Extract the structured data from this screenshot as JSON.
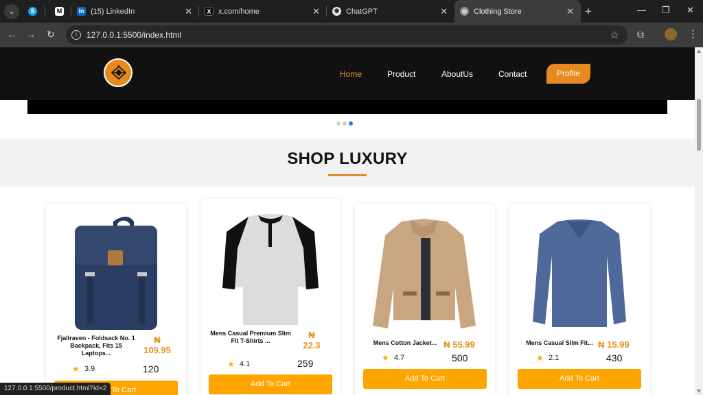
{
  "browser": {
    "tabs": [
      {
        "title": "",
        "icon": "skype-icon"
      },
      {
        "title": "",
        "icon": "medium-icon"
      },
      {
        "title": "(15) LinkedIn",
        "icon": "linkedin-icon"
      },
      {
        "title": "x.com/home",
        "icon": "x-icon"
      },
      {
        "title": "ChatGPT",
        "icon": "chatgpt-icon"
      },
      {
        "title": "Clothing Store",
        "icon": "globe-icon"
      }
    ],
    "url": "127.0.0.1:5500/index.html",
    "status_url": "127.0.0.1:5500/product.html?id=2"
  },
  "site": {
    "nav": {
      "home": "Home",
      "product": "Product",
      "about": "AboutUs",
      "contact": "Contact",
      "profile": "Profile"
    },
    "section_title": "SHOP LUXURY",
    "colors": {
      "accent": "#e8891f",
      "price": "#e8911f",
      "button": "#ffa500",
      "carousel_active": "#1677ff"
    },
    "products": [
      {
        "name": "Fjallraven - Foldsack No. 1 Backpack, Fits 15 Laptops...",
        "price": "₦\n109.95",
        "rating": "3.9",
        "count": "120",
        "button": "Add To Cart"
      },
      {
        "name": "Mens Casual Premium Slim Fit T-Shirts ...",
        "price": "₦\n22.3",
        "rating": "4.1",
        "count": "259",
        "button": "Add To Cart"
      },
      {
        "name": "Mens Cotton Jacket...",
        "price": "₦ 55.99",
        "rating": "4.7",
        "count": "500",
        "button": "Add To Cart"
      },
      {
        "name": "Mens Casual Slim Fit...",
        "price": "₦ 15.99",
        "rating": "2.1",
        "count": "430",
        "button": "Add To Cart"
      }
    ]
  }
}
